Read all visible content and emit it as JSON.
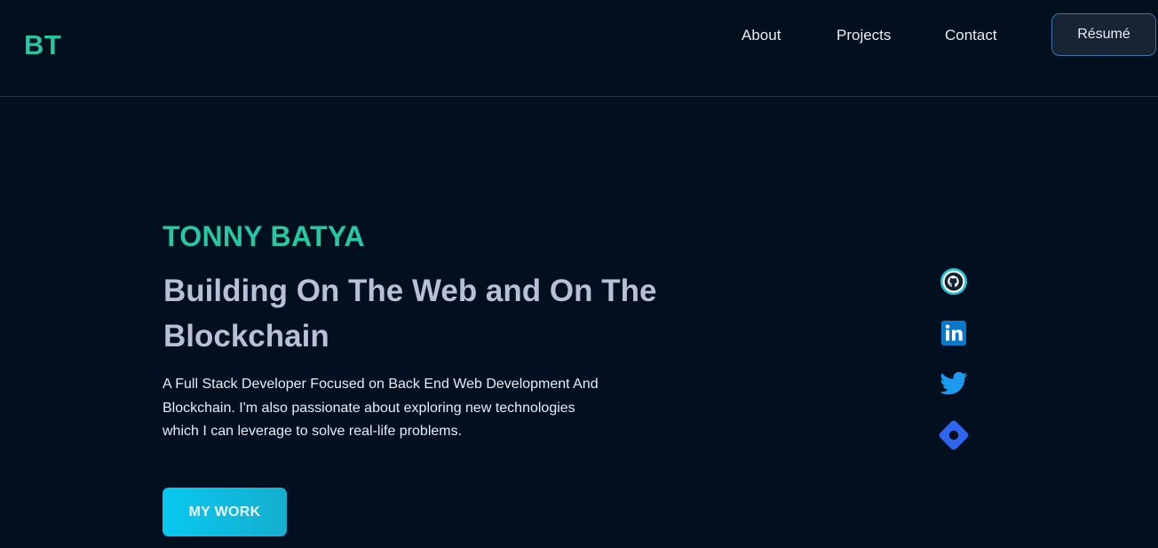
{
  "header": {
    "logo": "BT",
    "nav": {
      "about": "About",
      "projects": "Projects",
      "contact": "Contact"
    },
    "resume_label": "Résumé"
  },
  "hero": {
    "name": "TONNY BATYA",
    "title": "Building On The Web and On The Blockchain",
    "description": "A Full Stack Developer Focused on Back End Web Development And Blockchain. I'm also passionate about exploring new technologies which I can leverage to solve real-life problems.",
    "cta_label": "MY WORK"
  },
  "social": [
    {
      "icon": "github-icon",
      "color": "#22c5d5"
    },
    {
      "icon": "linkedin-icon",
      "color": "#0a78c8"
    },
    {
      "icon": "twitter-icon",
      "color": "#1d9bf0"
    },
    {
      "icon": "diamond-link-icon",
      "color": "#2f66f0"
    }
  ],
  "colors": {
    "background": "#010f1f",
    "accent": "#27c6a2",
    "title": "#b8bfd6",
    "cta": "#08c8ef"
  }
}
